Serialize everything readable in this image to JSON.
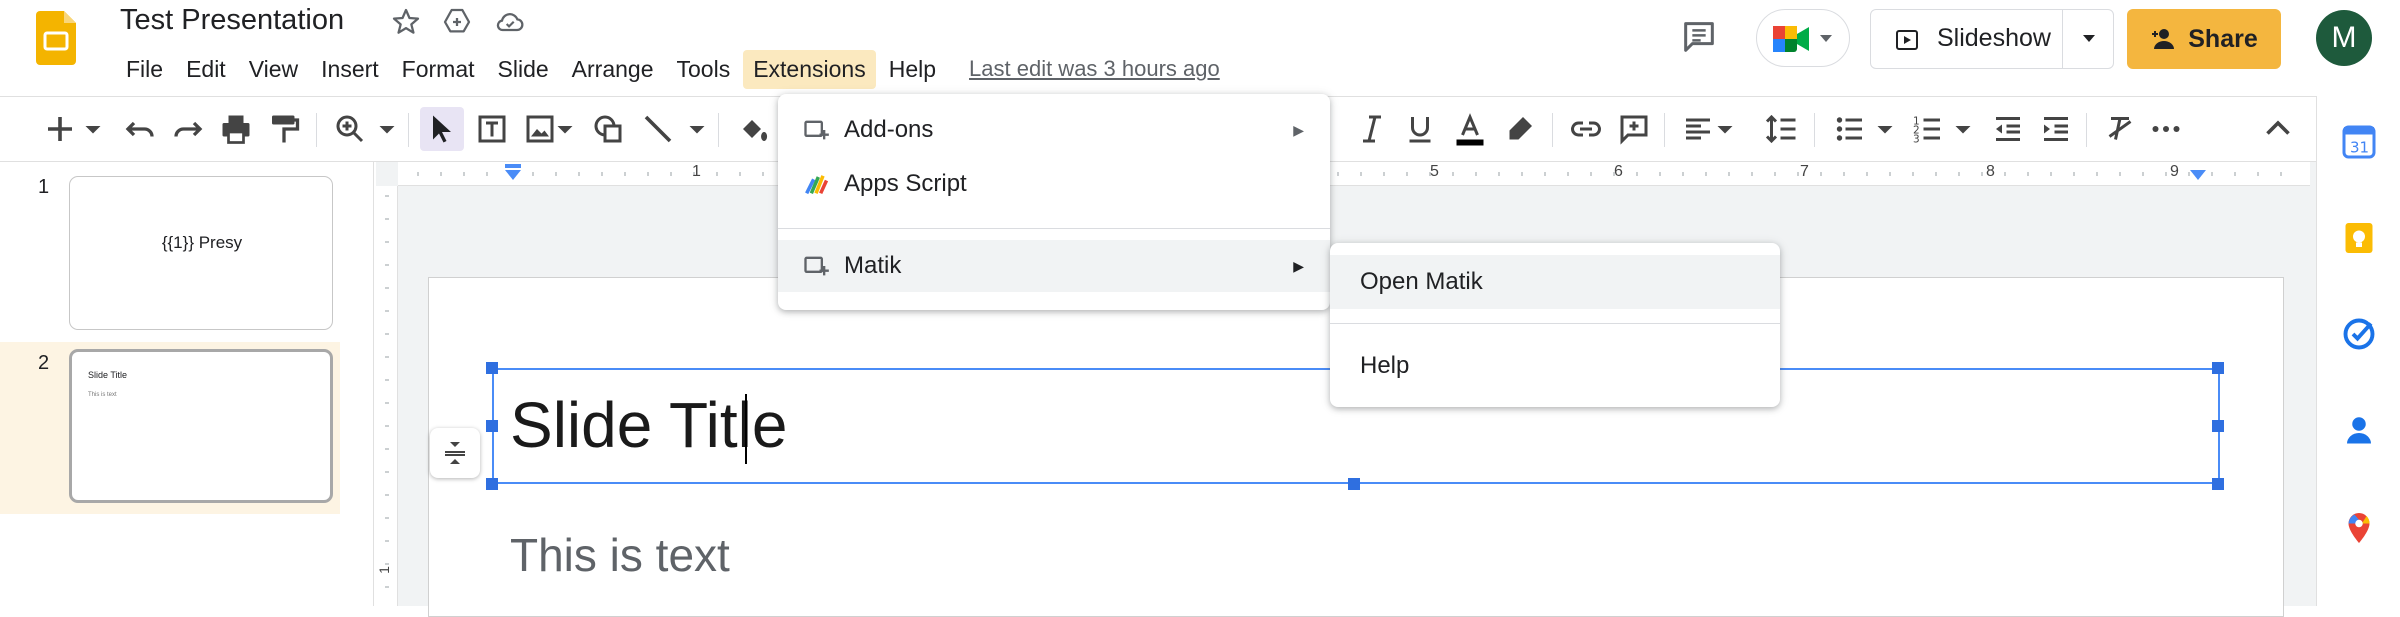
{
  "app": {
    "doc_title": "Test Presentation",
    "last_edit": "Last edit was 3 hours ago"
  },
  "menubar": {
    "items": [
      "File",
      "Edit",
      "View",
      "Insert",
      "Format",
      "Slide",
      "Arrange",
      "Tools",
      "Extensions",
      "Help"
    ],
    "active": "Extensions"
  },
  "header": {
    "slideshow_label": "Slideshow",
    "share_label": "Share",
    "avatar_initial": "M"
  },
  "colors": {
    "share_bg": "#f4b63f",
    "selection_blue": "#4a8cf7",
    "menu_active_bg": "#fbe9bf",
    "avatar_bg": "#1e5a3c",
    "slides_logo": "#f4b400"
  },
  "ruler": {
    "labels": [
      "1",
      "1",
      "5",
      "6",
      "7",
      "8",
      "9"
    ]
  },
  "filmstrip": {
    "slides": [
      {
        "number": "1",
        "text": "{{1}} Presy"
      },
      {
        "number": "2",
        "title": "Slide Title",
        "body": "This is text"
      }
    ]
  },
  "slide": {
    "title": "Slide Title",
    "body": "This is text"
  },
  "extensions_menu": {
    "items": [
      {
        "label": "Add-ons",
        "icon": "addon-icon",
        "has_submenu": true
      },
      {
        "label": "Apps Script",
        "icon": "apps-script-icon",
        "has_submenu": false
      },
      {
        "label": "Matik",
        "icon": "addon-icon",
        "has_submenu": true,
        "hover": true
      }
    ]
  },
  "matik_submenu": {
    "items": [
      {
        "label": "Open Matik",
        "hover": true
      },
      {
        "label": "Help"
      }
    ]
  },
  "side_panel": {
    "icons": [
      "calendar-icon",
      "keep-icon",
      "tasks-icon",
      "contacts-icon",
      "maps-icon"
    ],
    "calendar_label": "31"
  }
}
